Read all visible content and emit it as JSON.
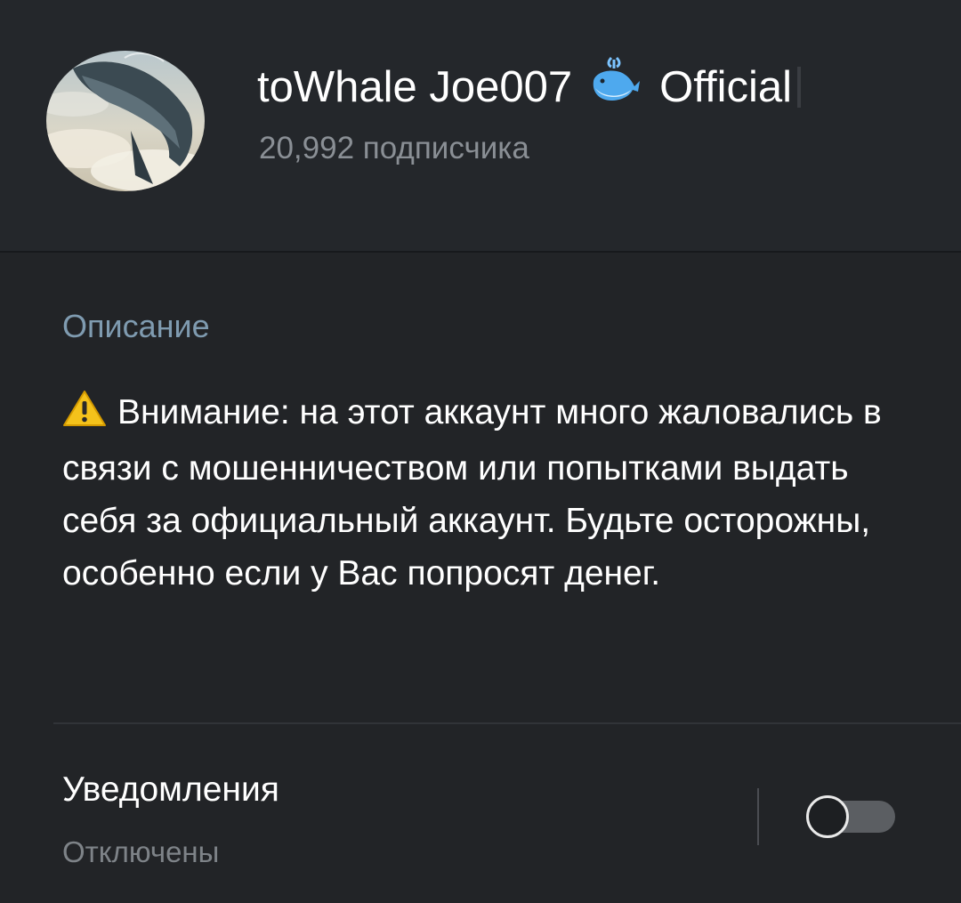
{
  "channel": {
    "title_prefix": "toWhale Joe007",
    "title_suffix": "Official",
    "subscribers": "20,992 подписчика",
    "avatar_icon": "whale-avatar",
    "badge_icon": "spouting-whale-emoji"
  },
  "description": {
    "label": "Описание",
    "warning_icon": "warning-sign",
    "text": "Внимание: на этот аккаунт много жаловались в связи с мошенничеством или попытками выдать себя за официальный аккаунт. Будьте осторожны, особенно если у Вас попросят денег."
  },
  "notifications": {
    "label": "Уведомления",
    "state": "Отключены",
    "enabled": false
  },
  "colors": {
    "background": "#222427",
    "header": "#24272b",
    "label_accent": "#7f9bb0",
    "secondary_text": "#7e8388"
  }
}
